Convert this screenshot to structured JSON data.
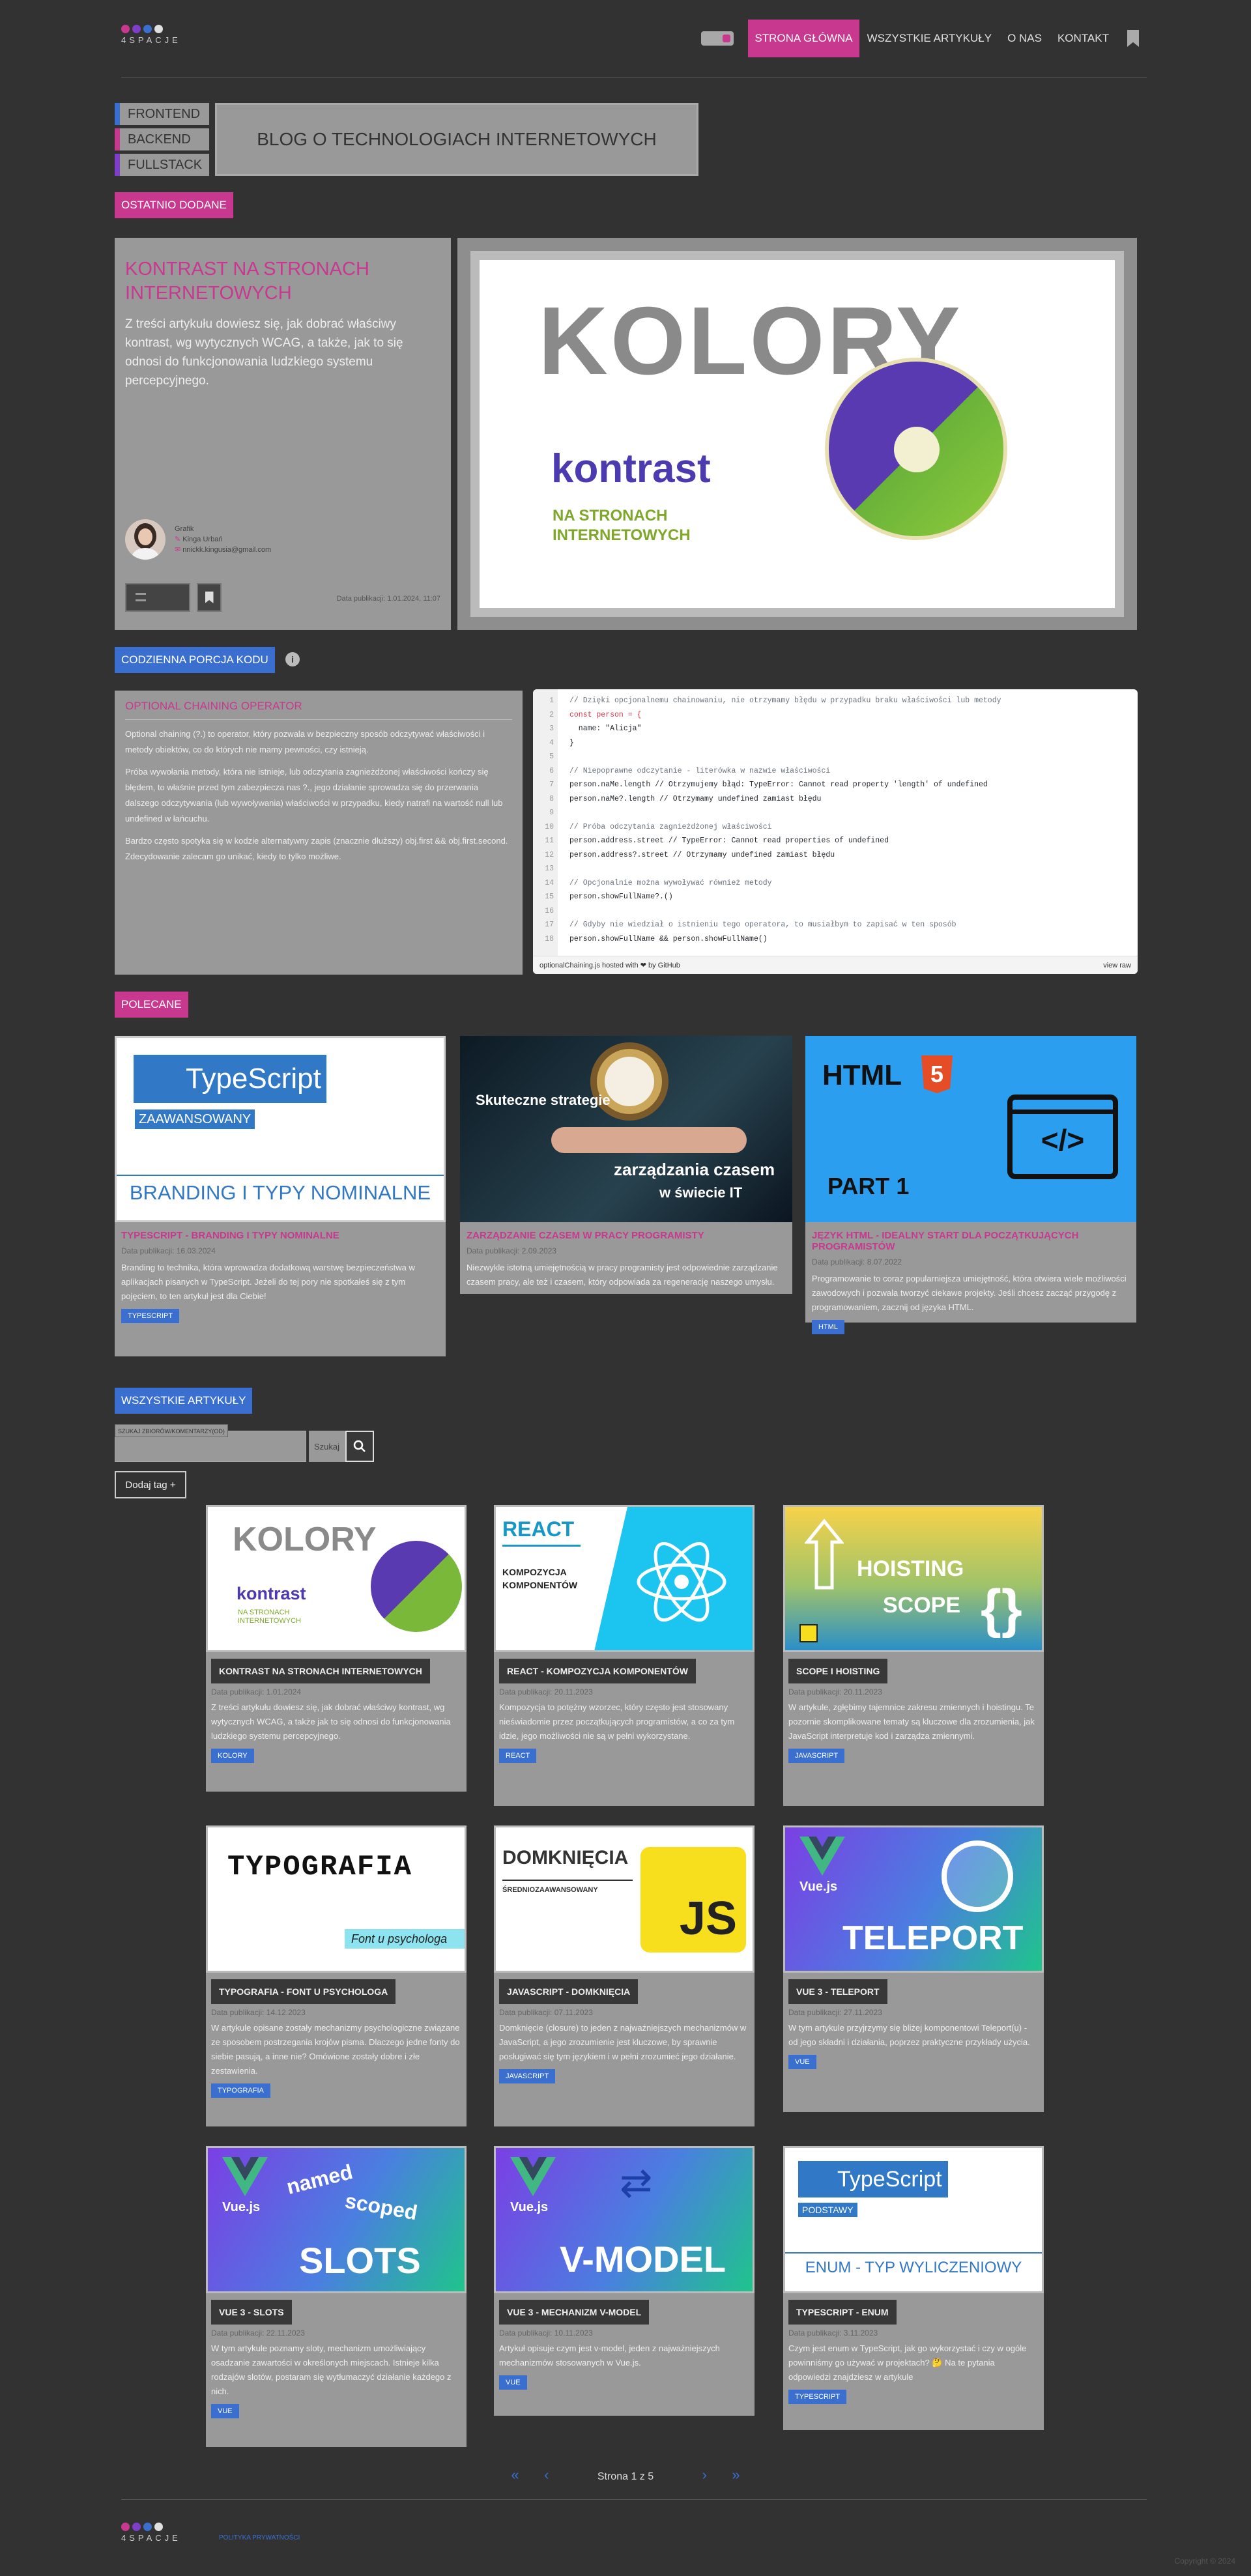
{
  "header": {
    "logo_text": "4SPACJE",
    "logo_colors": [
      "#c9388f",
      "#7e3ec9",
      "#3a6fd0",
      "#e0e0e0"
    ],
    "nav": [
      "STRONA GŁÓWNA",
      "WSZYSTKIE ARTYKUŁY",
      "O NAS",
      "KONTAKT"
    ]
  },
  "hero": {
    "tags": [
      "FRONTEND",
      "BACKEND",
      "FULLSTACK"
    ],
    "tag_colors": [
      "#3a6fd0",
      "#c9388f",
      "#7e3ec9"
    ],
    "title": "BLOG O TECHNOLOGIACH INTERNETOWYCH"
  },
  "recent": {
    "label": "OSTATNIO DODANE",
    "title": "KONTRAST NA STRONACH INTERNETOWYCH",
    "desc": "Z treści artykułu dowiesz się, jak dobrać właściwy kontrast, wg wytycznych WCAG, a także, jak to się odnosi do funkcjonowania ludzkiego systemu percepcyjnego.",
    "author_role": "Grafik",
    "author_name": "Kinga Urbań",
    "author_email": "nnickk.kingusia@gmail.com",
    "date": "Data publikacji: 1.01.2024, 11:07",
    "image": {
      "word": "KOLORY",
      "sub": "kontrast",
      "sub2": "NA STRONACH\nINTERNETOWYCH"
    }
  },
  "code": {
    "label": "CODZIENNA PORCJA KODU",
    "title": "OPTIONAL CHAINING OPERATOR",
    "p1": "Optional chaining (?.) to operator, który pozwala w bezpieczny sposób odczytywać właściwości i metody obiektów, co do których nie mamy pewności, czy istnieją.",
    "p2": "Próba wywołania metody, która nie istnieje, lub odczytania zagnieżdżonej właściwości kończy się błędem, to właśnie przed tym zabezpiecza nas ?., jego działanie sprowadza się do przerwania dalszego odczytywania (lub wywoływania) właściwości w przypadku, kiedy natrafi na wartość null lub undefined w łańcuchu.",
    "p3": "Bardzo często spotyka się w kodzie alternatywny zapis (znacznie dłuższy) obj.first && obj.first.second. Zdecydowanie zalecam go unikać, kiedy to tylko możliwe.",
    "lines": [
      "// Dzięki opcjonalnemu chainowaniu, nie otrzymamy błędu w przypadku braku właściwości lub metody",
      "const person = {",
      "  name: \"Alicja\"",
      "}",
      "",
      "// Niepoprawne odczytanie - literówka w nazwie właściwości",
      "person.naMe.length // Otrzymujemy błąd: TypeError: Cannot read property 'length' of undefined",
      "person.naMe?.length // Otrzymamy undefined zamiast błędu",
      "",
      "// Próba odczytania zagnieżdżonej właściwości",
      "person.address.street // TypeError: Cannot read properties of undefined",
      "person.address?.street // Otrzymamy undefined zamiast błędu",
      "",
      "// Opcjonalnie można wywoływać również metody",
      "person.showFullName?.()",
      "",
      "// Gdyby nie wiedział o istnieniu tego operatora, to musiałbym to zapisać w ten sposób",
      "person.showFullName && person.showFullName()"
    ],
    "footer_file": "optionalChaining.js hosted with ❤ by GitHub",
    "footer_raw": "view raw"
  },
  "featured": {
    "label": "POLECANE",
    "cards": [
      {
        "title": "TYPESCRIPT - BRANDING I TYPY NOMINALNE",
        "date": "Data publikacji: 16.03.2024",
        "desc": "Branding to technika, która wprowadza dodatkową warstwę bezpieczeństwa w aplikacjach pisanych w TypeScript. Jeżeli do tej pory nie spotkałeś się z tym pojęciem, to ten artykuł jest dla Ciebie!",
        "tag": "TYPESCRIPT"
      },
      {
        "title": "ZARZĄDZANIE CZASEM W PRACY PROGRAMISTY",
        "date": "Data publikacji: 2.09.2023",
        "desc": "Niezwykle istotną umiejętnością w pracy programisty jest odpowiednie zarządzanie czasem pracy, ale też i czasem, który odpowiada za regenerację naszego umysłu.",
        "tag": ""
      },
      {
        "title": "JĘZYK HTML - IDEALNY START DLA POCZĄTKUJĄCYCH PROGRAMISTÓW",
        "date": "Data publikacji: 8.07.2022",
        "desc": "Programowanie to coraz popularniejsza umiejętność, która otwiera wiele możliwości zawodowych i pozwala tworzyć ciekawe projekty. Jeśli chcesz zacząć przygodę z programowaniem, zacznij od języka HTML.",
        "tag": "HTML"
      }
    ],
    "img1": {
      "brand": "TypeScript",
      "badge": "ZAAWANSOWANY",
      "caption": "BRANDING I TYPY NOMINALNE"
    },
    "img2": {
      "l1": "Skuteczne strategie",
      "l2": "zarządzania czasem",
      "l3": "w świecie IT"
    },
    "img3": {
      "brand": "HTML",
      "num": "5",
      "part": "PART 1"
    }
  },
  "all": {
    "label": "WSZYSTKIE ARTYKUŁY",
    "search_label": "SZUKAJ ZBIORÓW/KOMENTARZY(OD)",
    "search_btn": "Szukaj",
    "add_tag": "Dodaj tag +",
    "cards": [
      {
        "title": "KONTRAST NA STRONACH INTERNETOWYCH",
        "date": "Data publikacji: 1.01.2024",
        "desc": "Z treści artykułu dowiesz się, jak dobrać właściwy kontrast, wg wytycznych WCAG, a także jak to się odnosi do funkcjonowania ludzkiego systemu percepcyjnego.",
        "tag": "KOLORY"
      },
      {
        "title": "REACT - KOMPOZYCJA KOMPONENTÓW",
        "date": "Data publikacji: 20.11.2023",
        "desc": "Kompozycja to potężny wzorzec, który często jest stosowany nieświadomie przez początkujących programistów, a co za tym idzie, jego możliwości nie są w pełni wykorzystane.",
        "tag": "REACT"
      },
      {
        "title": "SCOPE I HOISTING",
        "date": "Data publikacji: 20.11.2023",
        "desc": "W artykule, zgłębimy tajemnice zakresu zmiennych i hoistingu. Te pozornie skomplikowane tematy są kluczowe dla zrozumienia, jak JavaScript interpretuje kod i zarządza zmiennymi.",
        "tag": "JAVASCRIPT"
      },
      {
        "title": "TYPOGRAFIA - FONT U PSYCHOLOGA",
        "date": "Data publikacji: 14.12.2023",
        "desc": "W artykule opisane zostały mechanizmy psychologiczne związane ze sposobem postrzegania krojów pisma. Dlaczego jedne fonty do siebie pasują, a inne nie? Omówione zostały dobre i złe zestawienia.",
        "tag": "TYPOGRAFIA"
      },
      {
        "title": "JAVASCRIPT - DOMKNIĘCIA",
        "date": "Data publikacji: 07.11.2023",
        "desc": "Domknięcie (closure) to jeden z najważniejszych mechanizmów w JavaScript, a jego zrozumienie jest kluczowe, by sprawnie posługiwać się tym językiem i w pełni zrozumieć jego działanie.",
        "tag": "JAVASCRIPT"
      },
      {
        "title": "VUE 3 - TELEPORT",
        "date": "Data publikacji: 27.11.2023",
        "desc": "W tym artykule przyjrzymy się bliżej komponentowi Teleport(u) - od jego składni i działania, poprzez praktyczne przykłady użycia.",
        "tag": "VUE"
      },
      {
        "title": "VUE 3 - SLOTS",
        "date": "Data publikacji: 22.11.2023",
        "desc": "W tym artykule poznamy sloty, mechanizm umożliwiający osadzanie zawartości w określonych miejscach. Istnieje kilka rodzajów slotów, postaram się wytłumaczyć działanie każdego z nich.",
        "tag": "VUE"
      },
      {
        "title": "VUE 3 - MECHANIZM V-MODEL",
        "date": "Data publikacji: 10.11.2023",
        "desc": "Artykuł opisuje czym jest v-model, jeden z najważniejszych mechanizmów stosowanych w Vue.js.",
        "tag": "VUE"
      },
      {
        "title": "TYPESCRIPT - ENUM",
        "date": "Data publikacji: 3.11.2023",
        "desc": "Czym jest enum w TypeScript, jak go wykorzystać i czy w ogóle powinniśmy go używać w projektach? 🤔 Na te pytania odpowiedzi znajdziesz w artykule",
        "tag": "TYPESCRIPT"
      }
    ],
    "images": {
      "react": {
        "word": "REACT",
        "l1": "KOMPOZYCJA",
        "l2": "KOMPONENTÓW"
      },
      "hoist": {
        "l1": "HOISTING",
        "l2": "SCOPE"
      },
      "typo": {
        "word": "TYPOGRAFIA",
        "sub": "Font u psychologa"
      },
      "clos": {
        "word": "DOMKNIĘCIA",
        "sub": "ŚREDNIOZAAWANSOWANY",
        "js": "JS"
      },
      "tele": {
        "brand": "Vue.js",
        "word": "TELEPORT"
      },
      "slots": {
        "brand": "Vue.js",
        "w1": "named",
        "w2": "scoped",
        "w3": "SLOTS"
      },
      "vmodel": {
        "brand": "Vue.js",
        "word": "V-MODEL"
      },
      "enum": {
        "brand": "TypeScript",
        "badge": "PODSTAWY",
        "caption": "ENUM - TYP WYLICZENIOWY"
      }
    }
  },
  "pager": {
    "text": "Strona 1 z 5",
    "first": "«",
    "prev": "‹",
    "next": "›",
    "last": "»"
  },
  "footer": {
    "logo_text": "4SPACJE",
    "policy": "POLITYKA PRYWATNOŚCI",
    "copyright": "Copyright © 2024"
  }
}
